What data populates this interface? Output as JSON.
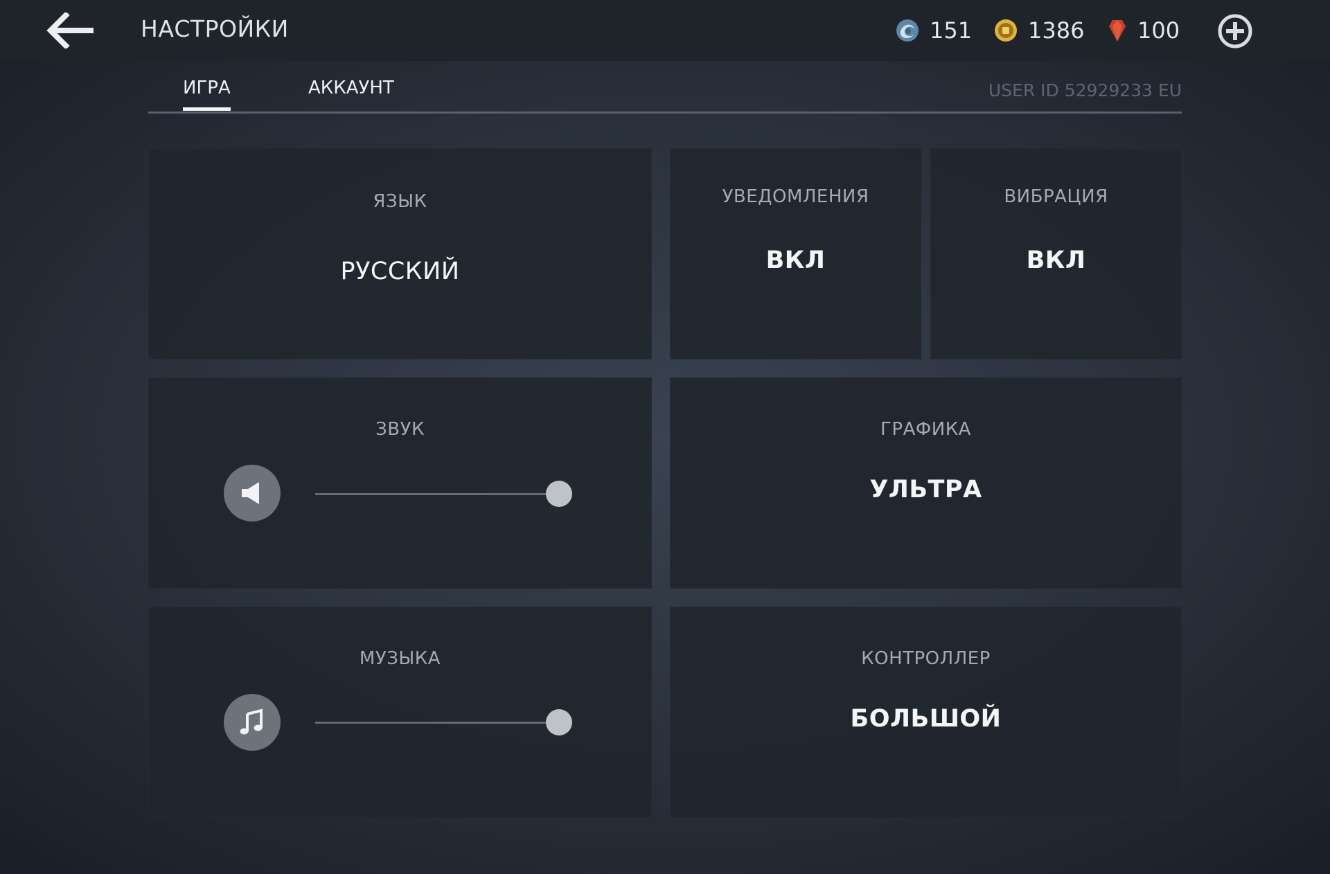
{
  "header": {
    "title": "НАСТРОЙКИ",
    "back_icon": "arrow-left-icon",
    "plus_icon": "plus-circle-icon",
    "currencies": [
      {
        "icon": "energy-icon",
        "value": "151",
        "color": "#7aa8c8"
      },
      {
        "icon": "coin-icon",
        "value": "1386",
        "color": "#e0b43a"
      },
      {
        "icon": "gem-icon",
        "value": "100",
        "color": "#c8402a"
      }
    ]
  },
  "tabs": [
    {
      "label": "ИГРА",
      "active": true
    },
    {
      "label": "АККАУНТ",
      "active": false
    }
  ],
  "user_id": "USER ID 52929233 EU",
  "settings": {
    "language": {
      "label": "ЯЗЫК",
      "value": "РУССКИЙ"
    },
    "notifications": {
      "label": "УВЕДОМЛЕНИЯ",
      "value": "ВКЛ"
    },
    "vibration": {
      "label": "ВИБРАЦИЯ",
      "value": "ВКЛ"
    },
    "sound": {
      "label": "ЗВУК",
      "icon": "speaker-icon",
      "level": 1.0
    },
    "graphics": {
      "label": "ГРАФИКА",
      "value": "УЛЬТРА"
    },
    "music": {
      "label": "МУЗЫКА",
      "icon": "music-note-icon",
      "level": 1.0
    },
    "controller": {
      "label": "КОНТРОЛЛЕР",
      "value": "БОЛЬШОЙ"
    }
  }
}
